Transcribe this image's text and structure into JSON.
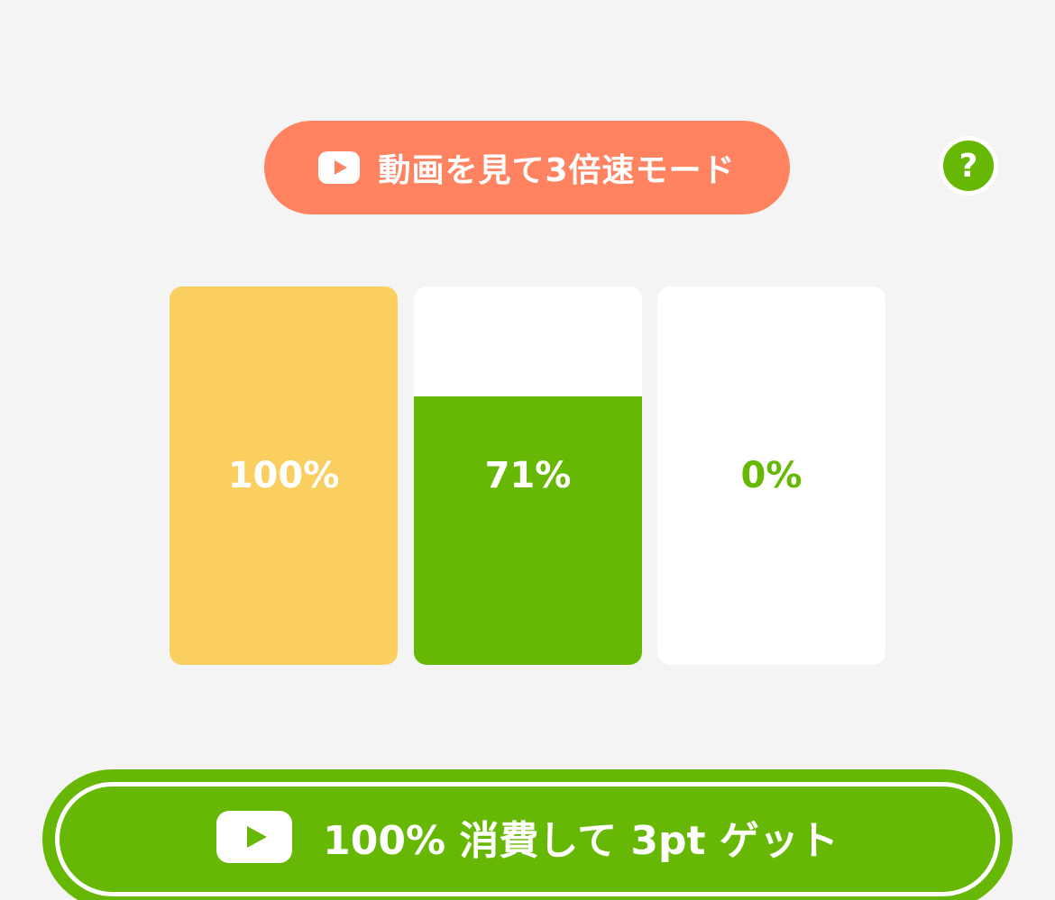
{
  "speed_mode": {
    "label": "動画を見て3倍速モード",
    "icon": "video-play-icon"
  },
  "help": {
    "label": "?",
    "icon": "question-icon"
  },
  "gauges": [
    {
      "label": "100%",
      "fill_fraction": 1.0,
      "fill_color": "#fbcf5f",
      "text_color": "#ffffff"
    },
    {
      "label": "71%",
      "fill_fraction": 0.71,
      "fill_color": "#66b804",
      "text_color": "#ffffff"
    },
    {
      "label": "0%",
      "fill_fraction": 0.0,
      "fill_color": "#66b804",
      "text_color": "#66b804"
    }
  ],
  "get_points": {
    "label": "100% 消費して 3pt ゲット",
    "icon": "video-play-icon"
  },
  "colors": {
    "background": "#f4f4f4",
    "accent_green": "#66b804",
    "speed_orange": "#ff8361",
    "full_yellow": "#fbcf5f"
  }
}
